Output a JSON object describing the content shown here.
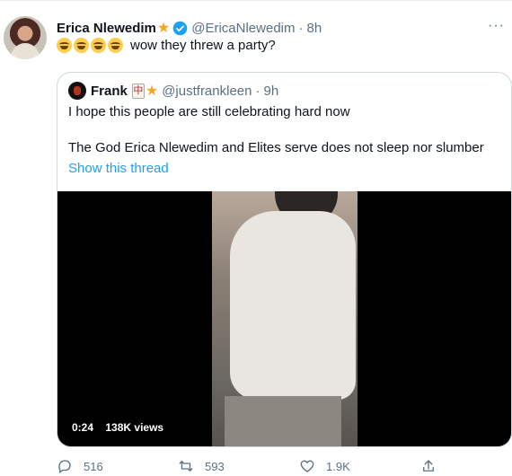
{
  "tweet": {
    "author_name": "Erica Nlewedim",
    "handle": "@EricaNlewedim",
    "separator": "·",
    "time": "8h",
    "text": "wow they threw a party?",
    "emoji_count": 4,
    "more": "···"
  },
  "quote": {
    "author_name": "Frank",
    "mahjong_glyph": "中",
    "handle": "@justfrankleen",
    "separator": "·",
    "time": "9h",
    "line1": "I hope this people are still celebrating hard now",
    "line2": "The God Erica Nlewedim and Elites serve does not sleep nor slumber",
    "show_thread": "Show this thread",
    "video": {
      "duration": "0:24",
      "views": "138K views"
    }
  },
  "actions": {
    "replies": "516",
    "retweets": "593",
    "likes": "1.9K"
  },
  "colors": {
    "accent": "#1da1f2",
    "muted": "#5b7083",
    "star": "#f5a623"
  }
}
